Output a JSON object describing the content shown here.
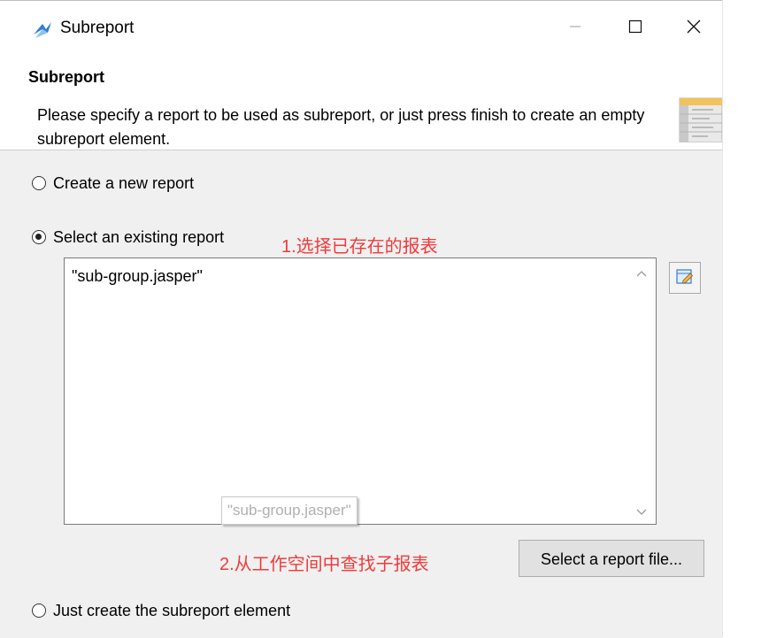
{
  "window": {
    "title": "Subreport",
    "icon": "jaspersoft-icon",
    "controls": [
      "minimize-icon",
      "maximize-icon",
      "close-icon"
    ]
  },
  "header": {
    "title": "Subreport",
    "description": "Please specify a report to be used as subreport, or just press finish to create an empty subreport element."
  },
  "options": {
    "create_new": {
      "label": "Create a new report",
      "selected": false
    },
    "select_existing": {
      "label": "Select an existing report",
      "selected": true
    },
    "just_create": {
      "label": "Just create the subreport element",
      "selected": false
    }
  },
  "expression": {
    "value": "\"sub-group.jasper\"",
    "tooltip": "\"sub-group.jasper\""
  },
  "annotations": {
    "step1": "1.选择已存在的报表",
    "step2": "2.从工作空间中查找子报表"
  },
  "buttons": {
    "select_file": "Select a report file..."
  },
  "colors": {
    "annotation": "#ee3b3b",
    "content_bg": "#f0f0f0"
  }
}
